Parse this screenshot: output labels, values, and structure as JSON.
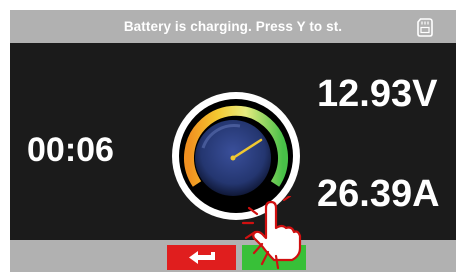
{
  "header": {
    "title": "Battery is charging. Press Y to st.",
    "sd_card_icon": "sd-card-icon"
  },
  "readings": {
    "elapsed_time": "00:06",
    "voltage": "12.93V",
    "current": "26.39A"
  },
  "gauge": {
    "icon": "charge-gauge-icon"
  },
  "footer": {
    "back_button_icon": "return-arrow-icon",
    "confirm_button_icon": "tap-hand-icon"
  },
  "colors": {
    "frame_background": "#1b1b1b",
    "bar_gray": "#b1b1b1",
    "back_button": "#e01e1e",
    "confirm_button": "#38c038",
    "hand_outline": "#d01010",
    "gauge_dial": "#2c3f80"
  }
}
